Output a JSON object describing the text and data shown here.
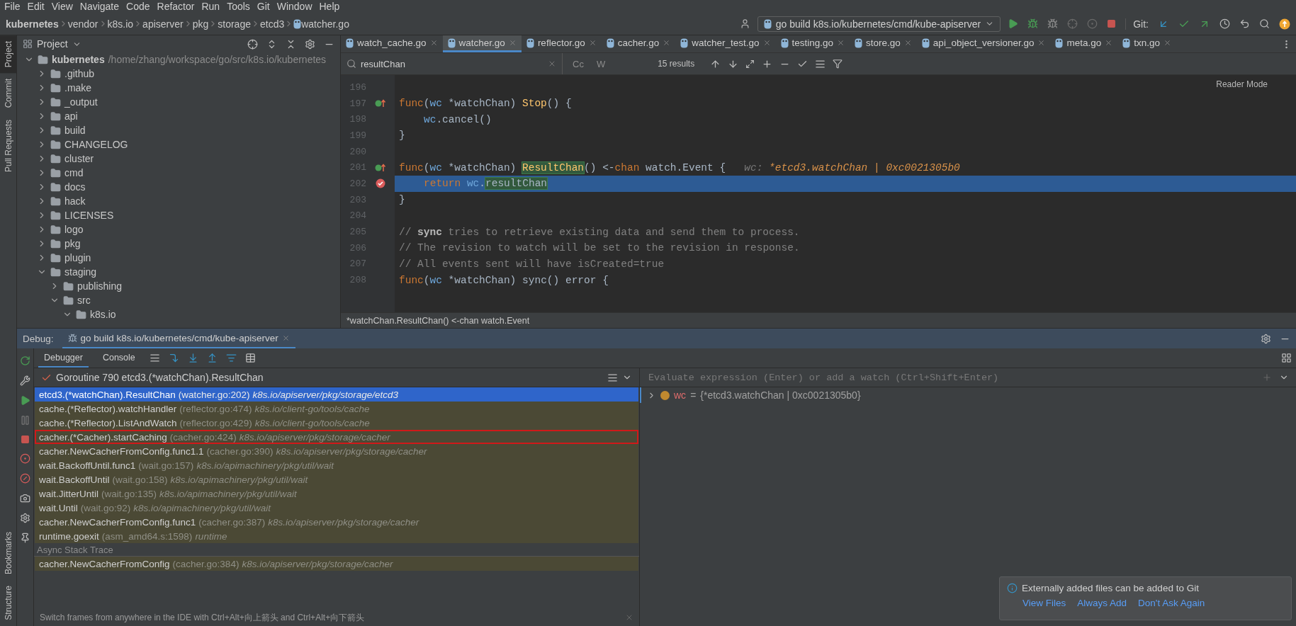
{
  "menu": [
    "File",
    "Edit",
    "View",
    "Navigate",
    "Code",
    "Refactor",
    "Run",
    "Tools",
    "Git",
    "Window",
    "Help"
  ],
  "breadcrumb": [
    "kubernetes",
    "vendor",
    "k8s.io",
    "apiserver",
    "pkg",
    "storage",
    "etcd3",
    "watcher.go"
  ],
  "run_config": "go build k8s.io/kubernetes/cmd/kube-apiserver",
  "git_label": "Git:",
  "left_stripe": {
    "top": [
      {
        "label": "Project",
        "selected": true
      },
      {
        "label": "Commit",
        "selected": false
      },
      {
        "label": "Pull Requests",
        "selected": false
      }
    ],
    "bottom": [
      {
        "label": "Bookmarks",
        "selected": false
      },
      {
        "label": "Structure",
        "selected": false
      }
    ]
  },
  "project_panel": {
    "title": "Project",
    "tree": [
      {
        "name": "kubernetes",
        "path": "/home/zhang/workspace/go/src/k8s.io/kubernetes",
        "expanded": true,
        "children": [
          {
            "name": ".github",
            "expanded": false
          },
          {
            "name": ".make",
            "expanded": false
          },
          {
            "name": "_output",
            "expanded": false
          },
          {
            "name": "api",
            "expanded": false
          },
          {
            "name": "build",
            "expanded": false
          },
          {
            "name": "CHANGELOG",
            "expanded": false
          },
          {
            "name": "cluster",
            "expanded": false
          },
          {
            "name": "cmd",
            "expanded": false
          },
          {
            "name": "docs",
            "expanded": false
          },
          {
            "name": "hack",
            "expanded": false
          },
          {
            "name": "LICENSES",
            "expanded": false
          },
          {
            "name": "logo",
            "expanded": false
          },
          {
            "name": "pkg",
            "expanded": false
          },
          {
            "name": "plugin",
            "expanded": false
          },
          {
            "name": "staging",
            "expanded": true,
            "children": [
              {
                "name": "publishing",
                "expanded": false
              },
              {
                "name": "src",
                "expanded": true,
                "children": [
                  {
                    "name": "k8s.io",
                    "expanded": true
                  }
                ]
              }
            ]
          }
        ]
      }
    ]
  },
  "editor": {
    "tabs": [
      {
        "label": "watch_cache.go",
        "selected": false
      },
      {
        "label": "watcher.go",
        "selected": true
      },
      {
        "label": "reflector.go",
        "selected": false
      },
      {
        "label": "cacher.go",
        "selected": false
      },
      {
        "label": "watcher_test.go",
        "selected": false
      },
      {
        "label": "testing.go",
        "selected": false
      },
      {
        "label": "store.go",
        "selected": false
      },
      {
        "label": "api_object_versioner.go",
        "selected": false
      },
      {
        "label": "meta.go",
        "selected": false
      },
      {
        "label": "txn.go",
        "selected": false
      }
    ],
    "search": {
      "value": "resultChan",
      "options": [
        "Cc",
        "W"
      ],
      "results": "15 results"
    },
    "reader_mode": "Reader Mode",
    "lines": [
      {
        "number": "196"
      },
      {
        "number": "197",
        "gutter": {
          "kind": "implements"
        },
        "indented": false,
        "segments": [
          {
            "text": "func",
            "kind": "keyword"
          },
          {
            "text": "(",
            "kind": "plain"
          },
          {
            "text": "wc",
            "kind": "receiver"
          },
          {
            "text": "*watchChan)",
            "kind": "plain"
          },
          {
            "text": "Stop",
            "kind": "function"
          },
          {
            "text": "() {",
            "kind": "plain"
          }
        ]
      },
      {
        "number": "198",
        "indented": true,
        "segments": [
          {
            "text": "wc",
            "kind": "receiver"
          },
          {
            "text": ".cancel()",
            "kind": "plain"
          }
        ]
      },
      {
        "number": "199",
        "indented": false,
        "segments": [
          {
            "text": "}",
            "kind": "plain"
          }
        ]
      },
      {
        "number": "200"
      },
      {
        "number": "201",
        "gutter": {
          "kind": "implements"
        },
        "indented": false,
        "segments": [
          {
            "text": "func",
            "kind": "keyword"
          },
          {
            "text": "(",
            "kind": "plain"
          },
          {
            "text": "wc",
            "kind": "receiver"
          },
          {
            "text": "*watchChan)",
            "kind": "plain"
          },
          {
            "text": "ResultChan",
            "kind": "match_function"
          },
          {
            "text": "() <-",
            "kind": "plain"
          },
          {
            "text": "chan",
            "kind": "keyword"
          },
          {
            "text": "watch.Event {",
            "kind": "plain"
          },
          {
            "text": "wc:",
            "kind": "hint_label"
          },
          {
            "text": "*etcd3.watchChan | 0xc0021305b0",
            "kind": "hint"
          }
        ]
      },
      {
        "number": "202",
        "gutter": {
          "kind": "breakpoint"
        },
        "current": true,
        "indented": true,
        "segments": [
          {
            "text": "return",
            "kind": "keyword"
          },
          {
            "text": "wc",
            "kind": "receiver"
          },
          {
            "text": ".",
            "kind": "plain"
          },
          {
            "text": "resultChan",
            "kind": "match"
          }
        ]
      },
      {
        "number": "203",
        "indented": false,
        "segments": [
          {
            "text": "}",
            "kind": "plain"
          }
        ]
      },
      {
        "number": "204"
      },
      {
        "number": "205",
        "indented": false,
        "segments": [
          {
            "text": "//",
            "kind": "comment"
          },
          {
            "text": "sync",
            "kind": "comment_reference"
          },
          {
            "text": "tries to retrieve existing data and send them to process.",
            "kind": "comment"
          }
        ]
      },
      {
        "number": "206",
        "indented": false,
        "segments": [
          {
            "text": "// The revision to watch will be set to the revision in response.",
            "kind": "comment"
          }
        ]
      },
      {
        "number": "207",
        "indented": false,
        "segments": [
          {
            "text": "// All events sent will have isCreated=true",
            "kind": "comment"
          }
        ]
      },
      {
        "number": "208",
        "indented": false,
        "segments": [
          {
            "text": "func",
            "kind": "keyword"
          },
          {
            "text": "(",
            "kind": "plain"
          },
          {
            "text": "wc",
            "kind": "receiver"
          },
          {
            "text": "*watchChan) sync() error {",
            "kind": "plain"
          }
        ]
      }
    ],
    "status": "*watchChan.ResultChan() <-chan watch.Event"
  },
  "debug": {
    "label": "Debug:",
    "session": "go build k8s.io/kubernetes/cmd/kube-apiserver",
    "tabs": [
      {
        "label": "Debugger",
        "selected": true
      },
      {
        "label": "Console",
        "selected": false
      }
    ],
    "thread": "Goroutine 790 etcd3.(*watchChan).ResultChan",
    "frames": [
      {
        "func": "etcd3.(*watchChan).ResultChan",
        "location": "(watcher.go:202)",
        "package": "k8s.io/apiserver/pkg/storage/etcd3",
        "selected": true,
        "outlined": false
      },
      {
        "func": "cache.(*Reflector).watchHandler",
        "location": "(reflector.go:474)",
        "package": "k8s.io/client-go/tools/cache",
        "selected": false,
        "outlined": false
      },
      {
        "func": "cache.(*Reflector).ListAndWatch",
        "location": "(reflector.go:429)",
        "package": "k8s.io/client-go/tools/cache",
        "selected": false,
        "outlined": false
      },
      {
        "func": "cacher.(*Cacher).startCaching",
        "location": "(cacher.go:424)",
        "package": "k8s.io/apiserver/pkg/storage/cacher",
        "selected": false,
        "outlined": true
      },
      {
        "func": "cacher.NewCacherFromConfig.func1.1",
        "location": "(cacher.go:390)",
        "package": "k8s.io/apiserver/pkg/storage/cacher",
        "selected": false,
        "outlined": false
      },
      {
        "func": "wait.BackoffUntil.func1",
        "location": "(wait.go:157)",
        "package": "k8s.io/apimachinery/pkg/util/wait",
        "selected": false,
        "outlined": false
      },
      {
        "func": "wait.BackoffUntil",
        "location": "(wait.go:158)",
        "package": "k8s.io/apimachinery/pkg/util/wait",
        "selected": false,
        "outlined": false
      },
      {
        "func": "wait.JitterUntil",
        "location": "(wait.go:135)",
        "package": "k8s.io/apimachinery/pkg/util/wait",
        "selected": false,
        "outlined": false
      },
      {
        "func": "wait.Until",
        "location": "(wait.go:92)",
        "package": "k8s.io/apimachinery/pkg/util/wait",
        "selected": false,
        "outlined": false
      },
      {
        "func": "cacher.NewCacherFromConfig.func1",
        "location": "(cacher.go:387)",
        "package": "k8s.io/apiserver/pkg/storage/cacher",
        "selected": false,
        "outlined": false
      },
      {
        "func": "runtime.goexit",
        "location": "(asm_amd64.s:1598)",
        "package": "runtime",
        "selected": false,
        "outlined": false
      }
    ],
    "async_label": "Async Stack Trace",
    "async_frames": [
      {
        "func": "cacher.NewCacherFromConfig",
        "location": "(cacher.go:384)",
        "package": "k8s.io/apiserver/pkg/storage/cacher",
        "selected": false,
        "outlined": false
      }
    ],
    "hint": "Switch frames from anywhere in the IDE with Ctrl+Alt+向上箭头 and Ctrl+Alt+向下箭头",
    "evaluate_placeholder": "Evaluate expression (Enter) or add a watch (Ctrl+Shift+Enter)",
    "variables": [
      {
        "name": "wc",
        "operator": "=",
        "value": "{*etcd3.watchChan | 0xc0021305b0}",
        "expanded": false
      }
    ]
  },
  "notification": {
    "text": "Externally added files can be added to Git",
    "actions": [
      "View Files",
      "Always Add",
      "Don't Ask Again"
    ]
  }
}
